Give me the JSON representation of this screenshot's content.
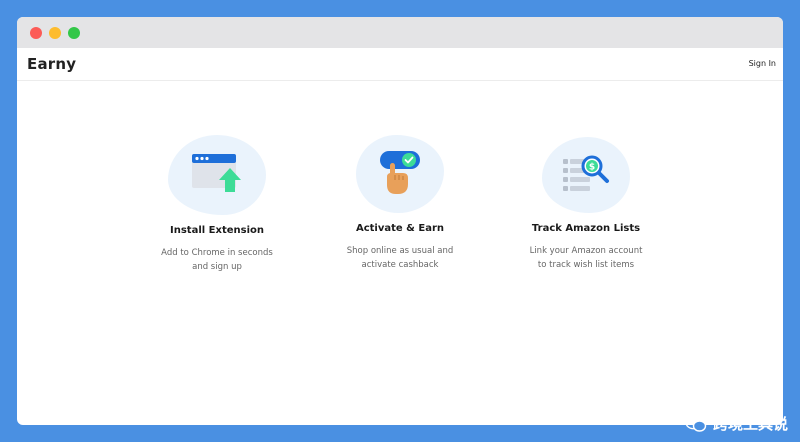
{
  "window": {
    "controls": [
      "close",
      "minimize",
      "maximize"
    ]
  },
  "navbar": {
    "logo": "Earny",
    "signin_label": "Sign In"
  },
  "features": [
    {
      "title": "Install Extension",
      "description": "Add to Chrome in seconds\nand sign up",
      "icon": "browser-upload-icon"
    },
    {
      "title": "Activate & Earn",
      "description": "Shop online as usual and\nactivate cashback",
      "icon": "tap-toggle-icon"
    },
    {
      "title": "Track Amazon Lists",
      "description": "Link your Amazon account\nto track wish list items",
      "icon": "list-search-dollar-icon"
    }
  ],
  "watermark": {
    "text": "跨境工具说",
    "icon": "wechat-icon"
  },
  "colors": {
    "background": "#4a90e2",
    "accent_blue": "#1e6fd9",
    "accent_green": "#3ddc97",
    "blob": "#eaf3fc"
  }
}
